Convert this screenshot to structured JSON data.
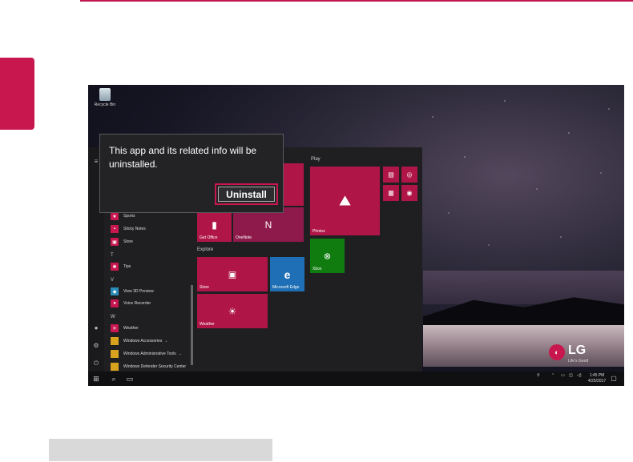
{
  "desktop": {
    "recycle_bin": "Recycle Bin"
  },
  "dialog": {
    "message": "This app and its related info will be uninstalled.",
    "button": "Uninstall"
  },
  "start_menu": {
    "apps": [
      {
        "type": "item",
        "label": "Sports"
      },
      {
        "type": "item",
        "label": "Sticky Notes"
      },
      {
        "type": "item",
        "label": "Store"
      },
      {
        "type": "letter",
        "label": "T"
      },
      {
        "type": "item",
        "label": "Tips"
      },
      {
        "type": "letter",
        "label": "V"
      },
      {
        "type": "item",
        "label": "View 3D Preview"
      },
      {
        "type": "item",
        "label": "Voice Recorder"
      },
      {
        "type": "letter",
        "label": "W"
      },
      {
        "type": "item",
        "label": "Weather"
      },
      {
        "type": "item",
        "label": "Windows Accessories"
      },
      {
        "type": "item",
        "label": "Windows Administrative Tools"
      },
      {
        "type": "item",
        "label": "Windows Defender Security Center"
      }
    ],
    "groups": {
      "play": "Play",
      "explore": "Explore"
    },
    "tiles": {
      "get_office": "Get Office",
      "onenote": "OneNote",
      "photos": "Photos",
      "store": "Store",
      "edge": "Microsoft Edge",
      "xbox": "Xbox",
      "weather": "Weather"
    }
  },
  "taskbar": {
    "time": "1:45 PM",
    "date": "4/25/2017"
  },
  "branding": {
    "logo": "LG",
    "tagline": "Life's Good"
  },
  "colors": {
    "accent": "#c8174f",
    "tile": "#b01548",
    "edge_tile": "#1e6fb5",
    "xbox_tile": "#107c10"
  }
}
